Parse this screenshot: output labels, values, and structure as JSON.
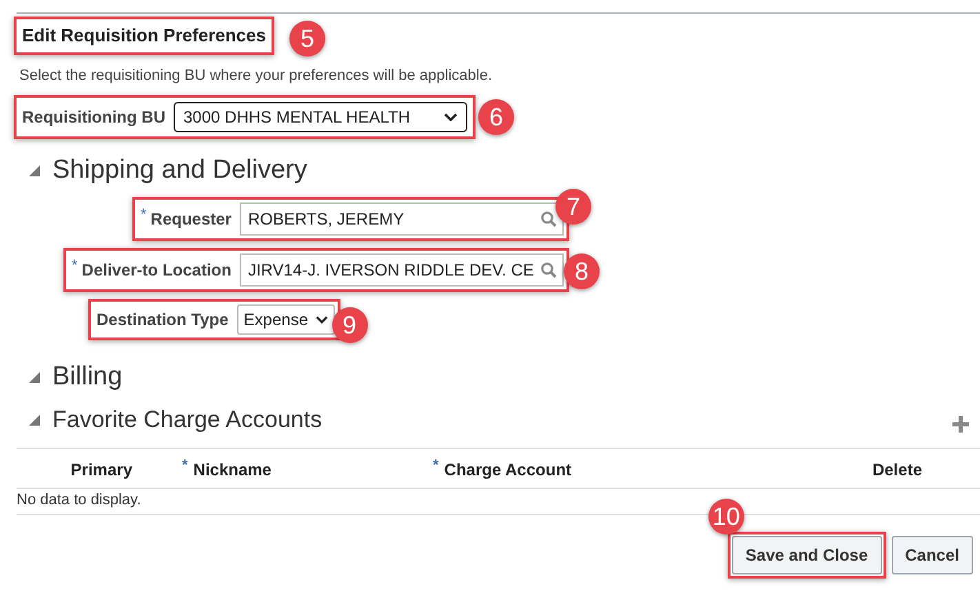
{
  "title": {
    "text": "Edit Requisition Preferences",
    "callout": "5"
  },
  "instruction": "Select the requisitioning BU where your preferences will be applicable.",
  "bu": {
    "label": "Requisitioning BU",
    "value": "3000 DHHS MENTAL HEALTH",
    "callout": "6"
  },
  "shipping": {
    "title": "Shipping and Delivery",
    "expanded": true,
    "fields": [
      {
        "label": "Requester",
        "required_mark": "*",
        "kind": "lov",
        "value": "ROBERTS, JEREMY",
        "callout": "7"
      },
      {
        "label": "Deliver-to Location",
        "required_mark": "*",
        "kind": "lov",
        "value": "JIRV14-J. IVERSON RIDDLE DEV. CE",
        "callout": "8"
      },
      {
        "label": "Destination Type",
        "kind": "select",
        "value": "Expense",
        "callout": "9"
      }
    ]
  },
  "billing": {
    "title": "Billing",
    "expanded": true
  },
  "favorites": {
    "title": "Favorite Charge Accounts",
    "expanded": true,
    "columns": [
      {
        "label": "Primary"
      },
      {
        "label": "Nickname",
        "required_mark": "*"
      },
      {
        "label": "Charge Account",
        "required_mark": "*"
      },
      {
        "label": "Delete"
      }
    ],
    "empty_text": "No data to display."
  },
  "buttons": [
    {
      "label": "Save and Close",
      "callout": "10"
    },
    {
      "label": "Cancel"
    }
  ]
}
